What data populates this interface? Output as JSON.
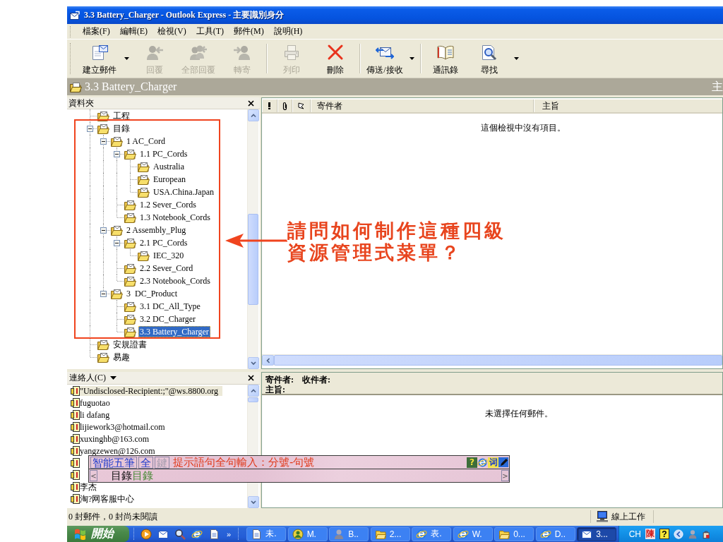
{
  "window": {
    "title": "3.3 Battery_Charger - Outlook Express - 主要識別身分"
  },
  "menu": [
    "檔案(F)",
    "編輯(E)",
    "檢視(V)",
    "工具(T)",
    "郵件(M)",
    "說明(H)"
  ],
  "toolbar": {
    "groups": [
      [
        {
          "kind": "compose",
          "label": "建立郵件",
          "disabled": false,
          "dropdown": true
        },
        {
          "kind": "reply",
          "label": "回覆",
          "disabled": true,
          "dropdown": false
        },
        {
          "kind": "replyall",
          "label": "全部回覆",
          "disabled": true,
          "dropdown": false
        },
        {
          "kind": "forward",
          "label": "轉寄",
          "disabled": true,
          "dropdown": false
        }
      ],
      [
        {
          "kind": "print",
          "label": "列印",
          "disabled": true,
          "dropdown": false
        },
        {
          "kind": "delete",
          "label": "刪除",
          "disabled": false,
          "dropdown": false
        }
      ],
      [
        {
          "kind": "sendreceive",
          "label": "傳送/接收",
          "disabled": false,
          "dropdown": true
        }
      ],
      [
        {
          "kind": "addressbook",
          "label": "通訊錄",
          "disabled": false,
          "dropdown": false
        },
        {
          "kind": "find",
          "label": "尋找",
          "disabled": false,
          "dropdown": true
        }
      ]
    ]
  },
  "folder_bar": {
    "title": "3.3 Battery_Charger",
    "identity": "主"
  },
  "folders": {
    "title": "資料夾",
    "tree": [
      {
        "label": "工程",
        "expanded": false,
        "selected": false
      },
      {
        "label": "目錄",
        "expanded": true,
        "selected": false,
        "children": [
          {
            "label": "1 AC_Cord",
            "expanded": true,
            "selected": false,
            "children": [
              {
                "label": "1.1 PC_Cords",
                "expanded": true,
                "selected": false,
                "children": [
                  {
                    "label": "Australia",
                    "expanded": false,
                    "selected": false
                  },
                  {
                    "label": "European",
                    "expanded": false,
                    "selected": false
                  },
                  {
                    "label": "USA.China.Japan",
                    "expanded": false,
                    "selected": false
                  }
                ]
              },
              {
                "label": "1.2 Sever_Cords",
                "expanded": false,
                "selected": false
              },
              {
                "label": "1.3 Notebook_Cords",
                "expanded": false,
                "selected": false
              }
            ]
          },
          {
            "label": "2 Assembly_Plug",
            "expanded": true,
            "selected": false,
            "children": [
              {
                "label": "2.1 PC_Cords",
                "expanded": true,
                "selected": false,
                "children": [
                  {
                    "label": "IEC_320",
                    "expanded": false,
                    "selected": false
                  }
                ]
              },
              {
                "label": "2.2 Sever_Cord",
                "expanded": false,
                "selected": false
              },
              {
                "label": "2.3 Notebook_Cords",
                "expanded": false,
                "selected": false
              }
            ]
          },
          {
            "label": "3  DC_Product",
            "expanded": true,
            "selected": false,
            "children": [
              {
                "label": "3.1 DC_All_Type",
                "expanded": false,
                "selected": false
              },
              {
                "label": "3.2 DC_Charger",
                "expanded": false,
                "selected": false
              },
              {
                "label": "3.3 Battery_Charger",
                "expanded": false,
                "selected": true
              }
            ]
          }
        ]
      },
      {
        "label": "安規證書",
        "expanded": false,
        "selected": false
      },
      {
        "label": "易趣",
        "expanded": false,
        "selected": false
      }
    ]
  },
  "message_list": {
    "columns": [
      "寄件者",
      "主旨"
    ],
    "empty_text": "這個檢視中沒有項目。"
  },
  "contacts": {
    "title": "連絡人(C)",
    "items": [
      {
        "kind": "contact",
        "name": "\"Undisclosed-Recipient:;\"@ws.8800.org",
        "selected": true
      },
      {
        "kind": "contact",
        "name": "fuguotao",
        "selected": false
      },
      {
        "kind": "contact",
        "name": "li dafang",
        "selected": false
      },
      {
        "kind": "contact",
        "name": "lijiework3@hotmail.com",
        "selected": false
      },
      {
        "kind": "contact",
        "name": "xuxinghb@163.com",
        "selected": false
      },
      {
        "kind": "contact",
        "name": "yangzewen@126.com",
        "selected": false
      },
      {
        "kind": "covered",
        "selected": false
      },
      {
        "kind": "covered",
        "selected": false
      },
      {
        "kind": "contact",
        "name": "李杰",
        "selected": false
      },
      {
        "kind": "contact",
        "name": "淘?网客服中心",
        "selected": false
      }
    ]
  },
  "preview": {
    "from_label": "寄件者:",
    "to_label": "收件者:",
    "subject_label": "主旨:",
    "empty_text": "未選擇任何郵件。"
  },
  "ime": {
    "buttons": [
      {
        "label": "智能五筆",
        "disabled": false
      },
      {
        "label": "全",
        "disabled": false
      },
      {
        "label": "鍵",
        "disabled": true
      }
    ],
    "hint": "提示語句全句輸入：分號-句號",
    "tools": [
      {
        "kind": "help",
        "glyph": "?"
      },
      {
        "kind": "browser"
      },
      {
        "kind": "dictionary",
        "glyph": "词"
      },
      {
        "kind": "pen"
      }
    ],
    "prev": "<",
    "composition": "目錄",
    "candidate": "目錄",
    "next": ">"
  },
  "status_bar": {
    "text": "0 封郵件，0 封尚未閱讀",
    "connection": "線上工作"
  },
  "taskbar": {
    "start": "開始",
    "quick_launch": [
      {
        "kind": "media"
      },
      {
        "kind": "mail"
      },
      {
        "kind": "search"
      },
      {
        "kind": "browser"
      },
      {
        "kind": "document"
      }
    ],
    "more": "»",
    "tasks": [
      {
        "kind": "document",
        "label": "未.",
        "selected": false
      },
      {
        "kind": "messenger",
        "label": "M.",
        "selected": false
      },
      {
        "kind": "person",
        "label": "B..",
        "selected": false
      },
      {
        "kind": "folder",
        "label": "2...",
        "selected": false
      },
      {
        "kind": "browser",
        "label": "表.",
        "selected": false
      },
      {
        "kind": "browser",
        "label": "W.",
        "selected": false
      },
      {
        "kind": "folder",
        "label": "0...",
        "selected": false
      },
      {
        "kind": "browser",
        "label": "D..",
        "selected": false
      },
      {
        "kind": "mail",
        "label": "3...",
        "selected": true
      }
    ],
    "tray": [
      {
        "kind": "text",
        "label": "CH"
      },
      {
        "kind": "ime",
        "label": "陳"
      },
      {
        "kind": "help",
        "label": "?"
      },
      {
        "kind": "back"
      },
      {
        "kind": "person"
      },
      {
        "kind": "bag"
      }
    ]
  },
  "annotation": {
    "question": "請問如何制作這種四級資源管理式菜單？"
  }
}
